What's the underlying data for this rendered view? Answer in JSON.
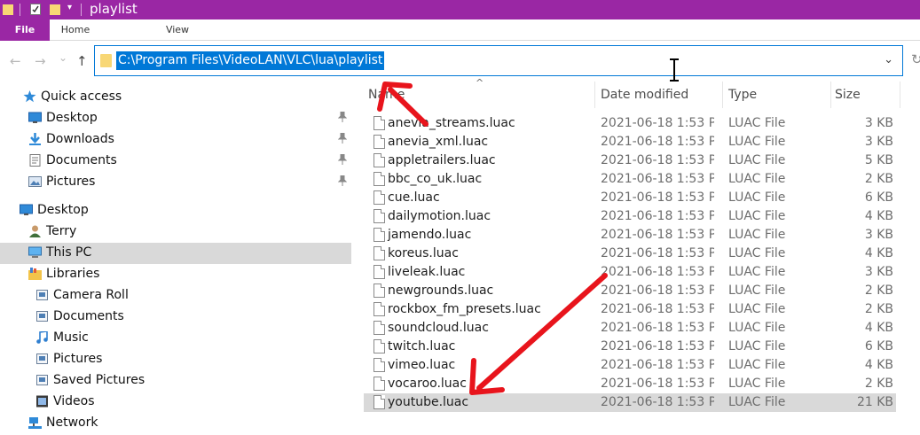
{
  "window": {
    "title": "playlist"
  },
  "ribbon": {
    "tabs": [
      "File",
      "Home",
      "View"
    ]
  },
  "nav": {
    "back": "←",
    "forward": "→",
    "recent": "⌄",
    "up": "↑",
    "address": "C:\\Program Files\\VideoLAN\\VLC\\lua\\playlist",
    "dropdown": "⌄",
    "refresh": "↻"
  },
  "sidebar": {
    "items": [
      {
        "label": "Quick access",
        "icon": "star-icon",
        "pinned": false
      },
      {
        "label": "Desktop",
        "icon": "desktop-icon",
        "pinned": true
      },
      {
        "label": "Downloads",
        "icon": "download-icon",
        "pinned": true
      },
      {
        "label": "Documents",
        "icon": "documents-icon",
        "pinned": true
      },
      {
        "label": "Pictures",
        "icon": "pictures-icon",
        "pinned": true
      },
      {
        "label": "Desktop",
        "icon": "desktop-icon",
        "pinned": false
      },
      {
        "label": "Terry",
        "icon": "user-icon",
        "pinned": false
      },
      {
        "label": "This PC",
        "icon": "computer-icon",
        "pinned": false
      },
      {
        "label": "Libraries",
        "icon": "libraries-icon",
        "pinned": false
      },
      {
        "label": "Camera Roll",
        "icon": "library-folder-icon",
        "pinned": false
      },
      {
        "label": "Documents",
        "icon": "library-folder-icon",
        "pinned": false
      },
      {
        "label": "Music",
        "icon": "music-icon",
        "pinned": false
      },
      {
        "label": "Pictures",
        "icon": "library-folder-icon",
        "pinned": false
      },
      {
        "label": "Saved Pictures",
        "icon": "library-folder-icon",
        "pinned": false
      },
      {
        "label": "Videos",
        "icon": "videos-icon",
        "pinned": false
      },
      {
        "label": "Network",
        "icon": "network-icon",
        "pinned": false
      }
    ],
    "pin_glyph": "📌"
  },
  "filelist": {
    "columns": [
      "Name",
      "Date modified",
      "Type",
      "Size"
    ],
    "sort_glyph": "^",
    "rows": [
      {
        "name": "anevia_streams.luac",
        "date": "2021-06-18 1:53 P...",
        "type": "LUAC File",
        "size": "3 KB"
      },
      {
        "name": "anevia_xml.luac",
        "date": "2021-06-18 1:53 P...",
        "type": "LUAC File",
        "size": "3 KB"
      },
      {
        "name": "appletrailers.luac",
        "date": "2021-06-18 1:53 P...",
        "type": "LUAC File",
        "size": "5 KB"
      },
      {
        "name": "bbc_co_uk.luac",
        "date": "2021-06-18 1:53 P...",
        "type": "LUAC File",
        "size": "2 KB"
      },
      {
        "name": "cue.luac",
        "date": "2021-06-18 1:53 P...",
        "type": "LUAC File",
        "size": "6 KB"
      },
      {
        "name": "dailymotion.luac",
        "date": "2021-06-18 1:53 P...",
        "type": "LUAC File",
        "size": "4 KB"
      },
      {
        "name": "jamendo.luac",
        "date": "2021-06-18 1:53 P...",
        "type": "LUAC File",
        "size": "3 KB"
      },
      {
        "name": "koreus.luac",
        "date": "2021-06-18 1:53 P...",
        "type": "LUAC File",
        "size": "4 KB"
      },
      {
        "name": "liveleak.luac",
        "date": "2021-06-18 1:53 P...",
        "type": "LUAC File",
        "size": "3 KB"
      },
      {
        "name": "newgrounds.luac",
        "date": "2021-06-18 1:53 P...",
        "type": "LUAC File",
        "size": "2 KB"
      },
      {
        "name": "rockbox_fm_presets.luac",
        "date": "2021-06-18 1:53 P...",
        "type": "LUAC File",
        "size": "2 KB"
      },
      {
        "name": "soundcloud.luac",
        "date": "2021-06-18 1:53 P...",
        "type": "LUAC File",
        "size": "4 KB"
      },
      {
        "name": "twitch.luac",
        "date": "2021-06-18 1:53 P...",
        "type": "LUAC File",
        "size": "6 KB"
      },
      {
        "name": "vimeo.luac",
        "date": "2021-06-18 1:53 P...",
        "type": "LUAC File",
        "size": "4 KB"
      },
      {
        "name": "vocaroo.luac",
        "date": "2021-06-18 1:53 P...",
        "type": "LUAC File",
        "size": "2 KB"
      },
      {
        "name": "youtube.luac",
        "date": "2021-06-18 1:53 P...",
        "type": "LUAC File",
        "size": "21 KB",
        "selected": true
      }
    ]
  },
  "colors": {
    "accent": "#9a27a4",
    "selection": "#0078d7",
    "annotation": "#e8141c"
  }
}
